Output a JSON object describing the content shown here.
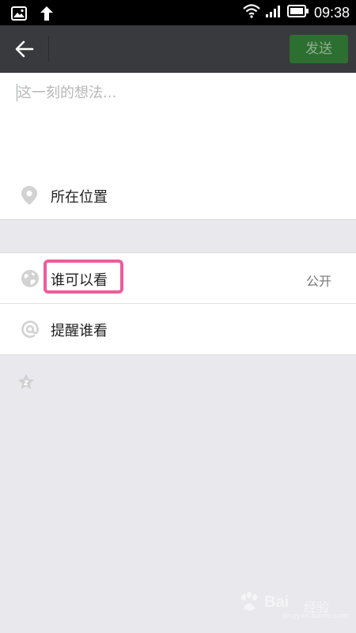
{
  "status_bar": {
    "time": "09:38",
    "icons": [
      "image-icon",
      "upload-arrow-icon",
      "wifi-icon",
      "signal-icon",
      "battery-icon"
    ]
  },
  "title_bar": {
    "send_label": "发送",
    "send_color": "#2c6f31"
  },
  "compose": {
    "placeholder": "这一刻的想法...",
    "location_label": "所在位置"
  },
  "settings": {
    "who_can_see_label": "谁可以看",
    "who_can_see_value": "公开",
    "remind_label": "提醒谁看",
    "highlight_color": "#ee5b9a"
  },
  "watermark": {
    "brand": "Bai",
    "suffix": "经验",
    "url": "jingyan.baidu.com"
  }
}
